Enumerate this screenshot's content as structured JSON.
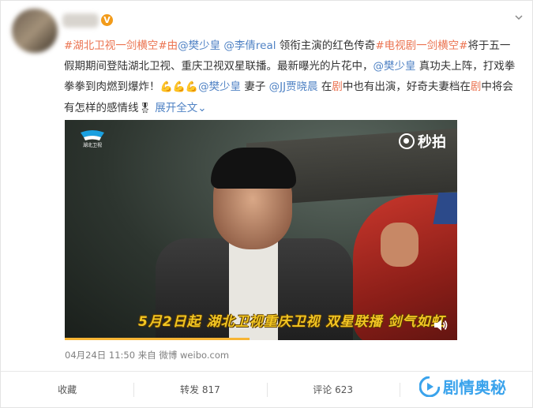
{
  "post": {
    "line1": {
      "t1": "#湖北卫视",
      "t2": "一剑横空",
      "t3": "#由",
      "t4": "@樊少皇",
      "t5": " ",
      "t6": "@李倩real",
      "t7": " 领衔主演的红色传奇",
      "t8": "#电视剧一剑横空#",
      "t9": "将于五一"
    },
    "line2": {
      "t1": "假期期间登陆湖北卫视、重庆卫视双星联播。最新曝光的片花中，",
      "t2": "@樊少皇",
      "t3": " 真功夫上阵，打戏拳"
    },
    "line3": {
      "t1": "拳拳到肉燃到爆炸！",
      "t2": "💪💪💪",
      "t3": "@樊少皇",
      "t4": " 妻子 ",
      "t5": "@JJ贾晓晨",
      "t6": " 在",
      "t7": "剧",
      "t8": "中也有出演，好奇夫妻档在",
      "t9": "剧",
      "t10": "中将会"
    },
    "line4": {
      "t1": "有怎样的感情线",
      "t2": "🎖",
      "t3": " 展开全文⌄"
    }
  },
  "video": {
    "channel_logo": "湖北卫视",
    "source": "秒拍",
    "subtitle": "5月2日起  湖北卫视重庆卫视  双星联播  剑气如虹",
    "progress": 0.47
  },
  "meta": "04月24日 11:50 来自 微博 weibo.com",
  "actions": {
    "collect": "收藏",
    "repost": "转发 817",
    "comment": "评论 623",
    "like": ""
  },
  "watermark": "剧情奥秘",
  "colors": {
    "link": "#eb7350",
    "mention": "#4f82c4",
    "subtitle": "#f2c623"
  }
}
